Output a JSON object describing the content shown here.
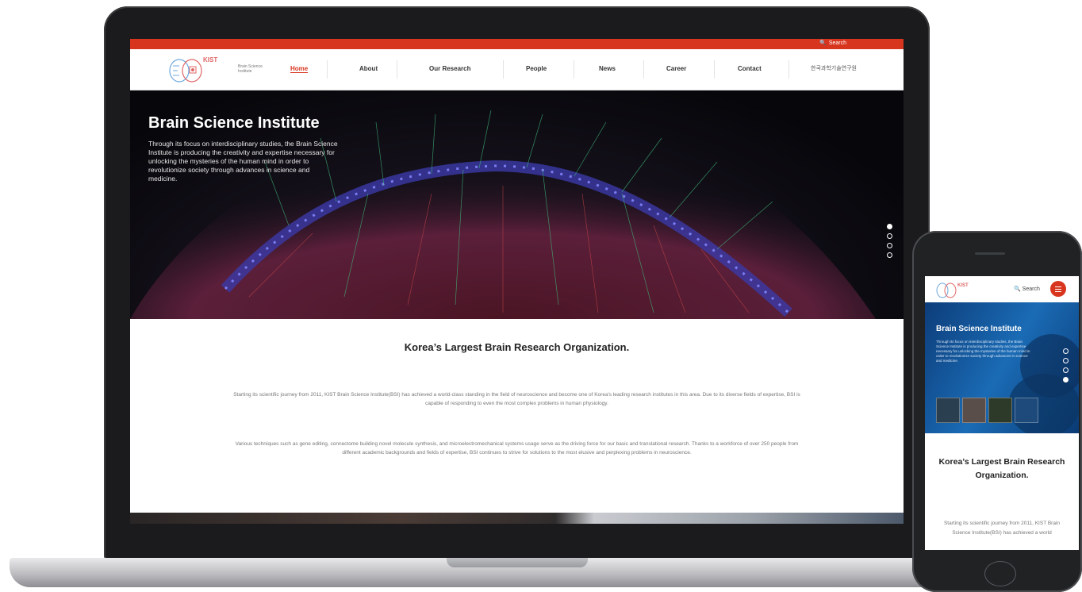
{
  "site": {
    "top_search": "Search",
    "logo_text": "Brain Science Institute",
    "nav": [
      "Home",
      "About",
      "Our Research",
      "People",
      "News",
      "Career",
      "Contact"
    ],
    "korean_link": "한국과학기술연구원",
    "hero_title": "Brain Science Institute",
    "hero_desc": "Through its focus on interdisciplinary studies, the Brain Science Institute is producing the creativity and expertise necessary for unlocking the mysteries of the human mind in order to revolutionize society through advances in science and medicine.",
    "intro_title": "Korea’s Largest Brain Research Organization.",
    "intro_p1": "Starting its scientific journey from 2011, KIST Brain Science Institute(BSI) has achieved a world-class standing in the field of neuroscience and become one of Korea's leading research institutes in this area. Due to its diverse fields of expertise, BSI is capable of responding to even the most complex problems in human physiology.",
    "intro_p2": "Various techniques such as gene editing, connectome building novel molecule synthesis, and microelectromechanical systems usage serve as the driving force for our basic and translational research. Thanks to a workforce of over 250 people from different academic backgrounds and fields of expertise, BSI continues to strive for solutions to the most elusive and perplexing problems in neuroscience."
  },
  "mobile": {
    "search": "Search",
    "hero_title": "Brain Science Institute",
    "hero_desc": "Through its focus on interdisciplinary studies, the Brain Science Institute is producing the creativity and expertise necessary for unlocking the mysteries of the human mind in order to revolutionize society through advances in science and medicine.",
    "title": "Korea’s Largest Brain Research Organization.",
    "text": "Starting its scientific journey from 2011, KIST Brain Science Institute(BSI) has achieved a world"
  },
  "colors": {
    "accent": "#d8351f",
    "hero_bg": "#07070b",
    "mobile_hero": "#1a6bb5"
  },
  "slider": {
    "desktop_active_dot": 1,
    "desktop_dots": 4,
    "mobile_active_dot": 4,
    "mobile_dots": 4
  }
}
